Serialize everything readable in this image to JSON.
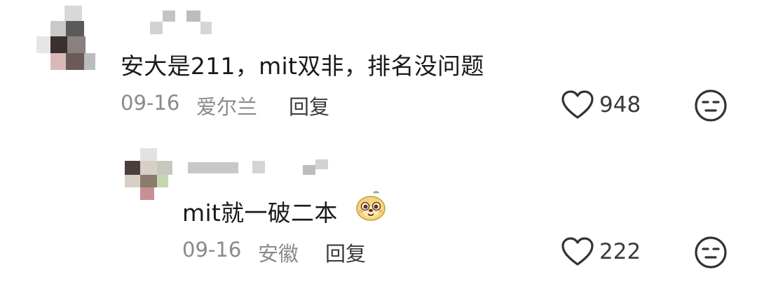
{
  "comments": [
    {
      "text": "安大是211，mit双非，排名没问题",
      "date": "09-16",
      "location": "爱尔兰",
      "reply_label": "回复",
      "likes": "948",
      "like_icon": "heart-outline-icon",
      "dislike_icon": "neutral-face-icon"
    }
  ],
  "replies": [
    {
      "text": "mit就一破二本",
      "emoji_icon": "dog-face-emoji-icon",
      "date": "09-16",
      "location": "安徽",
      "reply_label": "回复",
      "likes": "222",
      "like_icon": "heart-outline-icon",
      "dislike_icon": "neutral-face-icon"
    }
  ],
  "colors": {
    "text_primary": "#1a1a1a",
    "text_meta": "#8a8a8a",
    "icon_stroke": "#333333"
  }
}
